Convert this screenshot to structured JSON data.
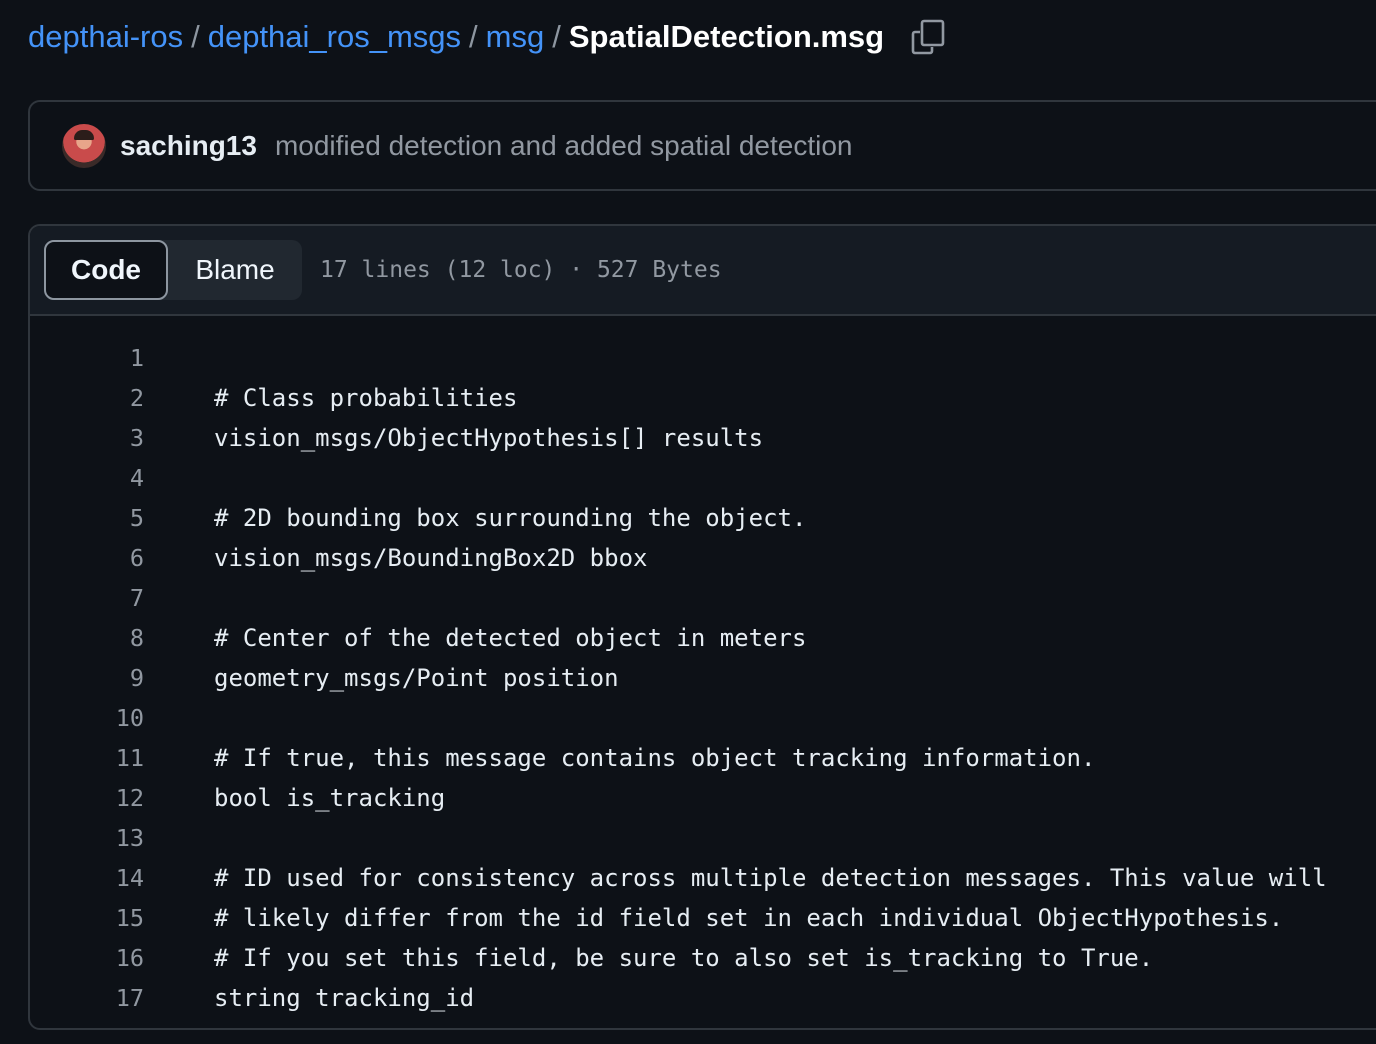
{
  "breadcrumb": {
    "items": [
      "depthai-ros",
      "depthai_ros_msgs",
      "msg"
    ],
    "separator": "/",
    "current": "SpatialDetection.msg",
    "copy_icon": "copy-icon"
  },
  "commit": {
    "author": "saching13",
    "message": "modified detection and added spatial detection"
  },
  "file": {
    "tabs": [
      "Code",
      "Blame"
    ],
    "active_tab": "Code",
    "meta": "17 lines (12 loc) · 527 Bytes",
    "lines": [
      {
        "num": "1",
        "code": ""
      },
      {
        "num": "2",
        "code": "# Class probabilities"
      },
      {
        "num": "3",
        "code": "vision_msgs/ObjectHypothesis[] results"
      },
      {
        "num": "4",
        "code": ""
      },
      {
        "num": "5",
        "code": "# 2D bounding box surrounding the object."
      },
      {
        "num": "6",
        "code": "vision_msgs/BoundingBox2D bbox"
      },
      {
        "num": "7",
        "code": ""
      },
      {
        "num": "8",
        "code": "# Center of the detected object in meters"
      },
      {
        "num": "9",
        "code": "geometry_msgs/Point position"
      },
      {
        "num": "10",
        "code": ""
      },
      {
        "num": "11",
        "code": "# If true, this message contains object tracking information."
      },
      {
        "num": "12",
        "code": "bool is_tracking"
      },
      {
        "num": "13",
        "code": ""
      },
      {
        "num": "14",
        "code": "# ID used for consistency across multiple detection messages. This value will"
      },
      {
        "num": "15",
        "code": "# likely differ from the id field set in each individual ObjectHypothesis."
      },
      {
        "num": "16",
        "code": "# If you set this field, be sure to also set is_tracking to True."
      },
      {
        "num": "17",
        "code": "string tracking_id"
      }
    ]
  },
  "colors": {
    "background": "#0d1117",
    "link": "#4493f8",
    "border": "#30363d",
    "muted": "#9198a1"
  }
}
